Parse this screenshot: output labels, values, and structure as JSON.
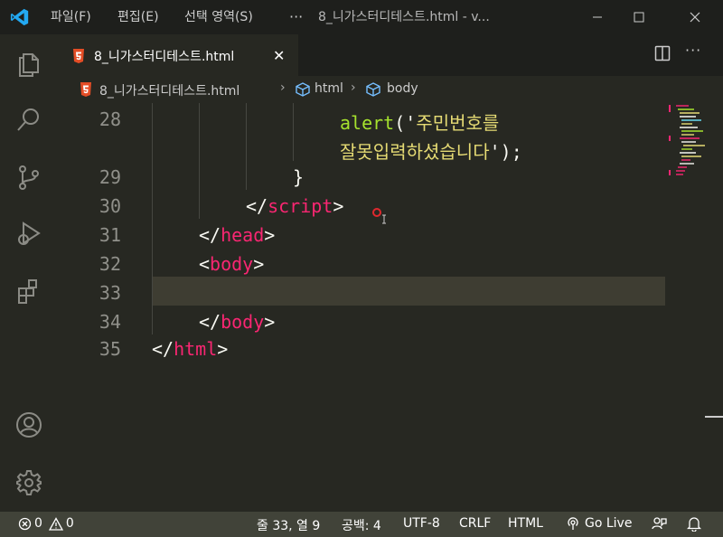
{
  "titlebar": {
    "menus": [
      "파일(F)",
      "편집(E)",
      "선택 영역(S)"
    ],
    "more": "···",
    "window_title": "8_니가스터디테스트.html - v..."
  },
  "tab": {
    "filename": "8_니가스터디테스트.html",
    "close": "✕"
  },
  "breadcrumb": {
    "file": "8_니가스터디테스트.html",
    "items": [
      "html",
      "body"
    ],
    "separator": "›"
  },
  "editor": {
    "lines": [
      {
        "number": "28",
        "parts": [
          {
            "text": "alert",
            "kind": "fn"
          },
          {
            "text": "('",
            "kind": "plain"
          },
          {
            "text": "주민번호를",
            "kind": "str"
          }
        ]
      },
      {
        "number": "",
        "parts": [
          {
            "text": "잘못입력하셨습니다",
            "kind": "str"
          },
          {
            "text": "');",
            "kind": "plain"
          }
        ]
      },
      {
        "number": "29",
        "parts": [
          {
            "text": "}",
            "kind": "plain"
          }
        ]
      },
      {
        "number": "30",
        "parts": [
          {
            "text": "</",
            "kind": "plain"
          },
          {
            "text": "script",
            "kind": "tag"
          },
          {
            "text": ">",
            "kind": "plain"
          }
        ]
      },
      {
        "number": "31",
        "parts": [
          {
            "text": "</",
            "kind": "plain"
          },
          {
            "text": "head",
            "kind": "tag"
          },
          {
            "text": ">",
            "kind": "plain"
          }
        ]
      },
      {
        "number": "32",
        "parts": [
          {
            "text": "<",
            "kind": "plain"
          },
          {
            "text": "body",
            "kind": "tag"
          },
          {
            "text": ">",
            "kind": "plain"
          }
        ]
      },
      {
        "number": "33",
        "parts": []
      },
      {
        "number": "34",
        "parts": [
          {
            "text": "</",
            "kind": "plain"
          },
          {
            "text": "body",
            "kind": "tag"
          },
          {
            "text": ">",
            "kind": "plain"
          }
        ]
      },
      {
        "number": "35",
        "parts": [
          {
            "text": "</",
            "kind": "plain"
          },
          {
            "text": "html",
            "kind": "tag"
          },
          {
            "text": ">",
            "kind": "plain"
          }
        ]
      }
    ]
  },
  "statusbar": {
    "errors": "0",
    "warnings": "0",
    "position": "줄 33, 열 9",
    "spaces": "공백: 4",
    "encoding": "UTF-8",
    "eol": "CRLF",
    "language": "HTML",
    "golive": "Go Live"
  },
  "colors": {
    "background": "#272822",
    "tag": "#f92672",
    "function": "#a6e22e",
    "string": "#e6db74",
    "line_number": "#90908a"
  },
  "icons": [
    "vscode-logo-icon",
    "explorer-icon",
    "search-icon",
    "source-control-icon",
    "run-debug-icon",
    "extensions-icon",
    "account-icon",
    "settings-gear-icon",
    "html5-file-icon",
    "split-editor-icon",
    "symbol-cube-icon",
    "error-icon",
    "warning-icon",
    "broadcast-icon",
    "feedback-icon",
    "bell-icon"
  ]
}
